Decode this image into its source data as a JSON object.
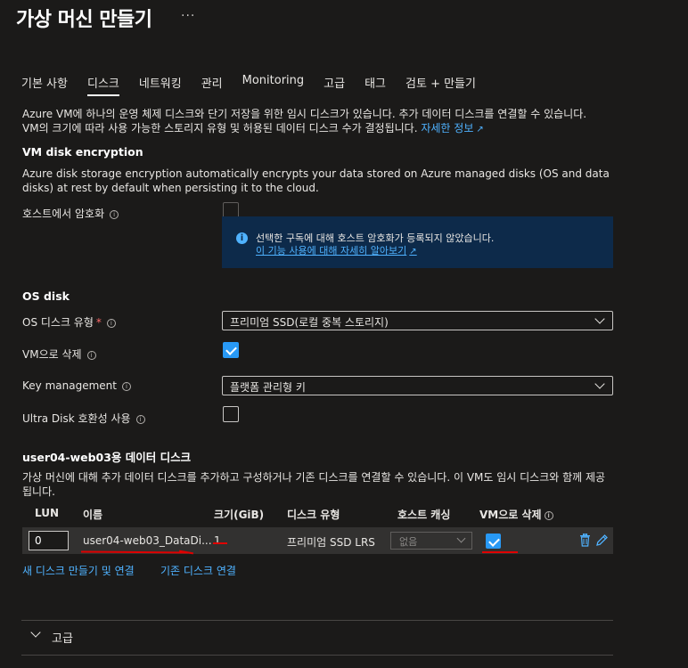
{
  "header": {
    "title": "가상 머신 만들기",
    "more": "···"
  },
  "tabs": [
    {
      "label": "기본 사항"
    },
    {
      "label": "디스크"
    },
    {
      "label": "네트워킹"
    },
    {
      "label": "관리"
    },
    {
      "label": "Monitoring"
    },
    {
      "label": "고급"
    },
    {
      "label": "태그"
    },
    {
      "label": "검토 + 만들기"
    }
  ],
  "intro": {
    "line1": "Azure VM에 하나의 운영 체제 디스크와 단기 저장을 위한 임시 디스크가 있습니다. 추가 데이터 디스크를 연결할 수 있습니다.",
    "line2": "VM의 크기에 따라 사용 가능한 스토리지 유형 및 허용된 데이터 디스크 수가 결정됩니다.",
    "link": "자세한 정보"
  },
  "encryption": {
    "title": "VM disk encryption",
    "description": "Azure disk storage encryption automatically encrypts your data stored on Azure managed disks (OS and data disks) at rest by default when persisting it to the cloud.",
    "host_label": "호스트에서 암호화",
    "info_text": "선택한 구독에 대해 호스트 암호화가 등록되지 않았습니다.",
    "info_link": "이 기능 사용에 대해 자세히 알아보기"
  },
  "os_disk": {
    "title": "OS disk",
    "type_label": "OS 디스크 유형",
    "required_mark": "*",
    "type_value": "프리미엄 SSD(로컬 중복 스토리지)",
    "delete_label": "VM으로 삭제",
    "key_label": "Key management",
    "key_value": "플랫폼 관리형 키",
    "ultra_label": "Ultra Disk 호환성 사용"
  },
  "data_disks": {
    "title": "user04-web03용 데이터 디스크",
    "description": "가상 머신에 대해 추가 데이터 디스크를 추가하고 구성하거나 기존 디스크를 연결할 수 있습니다. 이 VM도 임시 디스크와 함께 제공됩니다.",
    "columns": {
      "lun": "LUN",
      "name": "이름",
      "size": "크기(GiB)",
      "type": "디스크 유형",
      "cache": "호스트 캐싱",
      "delete": "VM으로 삭제"
    },
    "rows": [
      {
        "lun": "0",
        "name": "user04-web03_DataDi...",
        "size": "1",
        "type": "프리미엄 SSD LRS",
        "cache": "없음",
        "delete_with_vm": true
      }
    ],
    "create_link": "새 디스크 만들기 및 연결",
    "attach_link": "기존 디스크 연결"
  },
  "advanced": {
    "label": "고급"
  },
  "colors": {
    "background": "#1b1a19",
    "link": "#4fb2ff",
    "checkbox": "#2899f5",
    "info_box": "#0d2a4a",
    "annotation": "#e00000"
  }
}
